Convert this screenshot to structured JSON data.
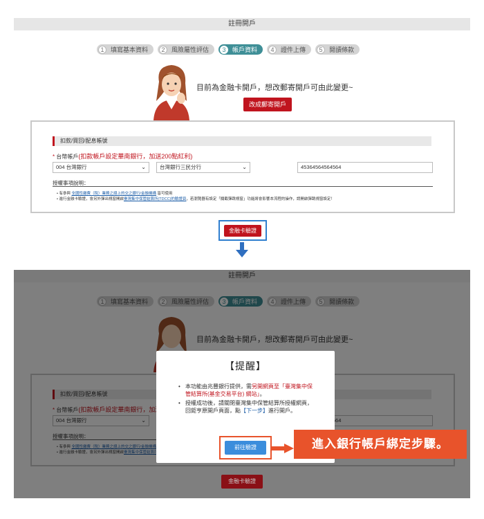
{
  "page_title": "註冊開戶",
  "steps": [
    {
      "num": "1",
      "label": "填寫基本資料",
      "active": false
    },
    {
      "num": "2",
      "label": "風險屬性評估",
      "active": false
    },
    {
      "num": "3",
      "label": "帳戶資料",
      "active": true
    },
    {
      "num": "4",
      "label": "證件上傳",
      "active": false
    },
    {
      "num": "5",
      "label": "閱讀條款",
      "active": false
    }
  ],
  "notice": "目前為金融卡開戶，想改郵寄開戶可由此變更~",
  "switch_button": "改成郵寄開戶",
  "form": {
    "section_title": "扣款/買回/配息帳號",
    "account_label_star": "*",
    "account_label": "台幣帳戶",
    "account_highlight": "(扣款帳戶設定華南銀行，加送200點紅利)",
    "bank_select": "004 台灣銀行",
    "branch_select": "台灣銀行三民分行",
    "account_number": "45364564564564",
    "explain_title": "授權事項說明：",
    "bullet1_pre": "• 有參與 ",
    "bullet1_link": "全國性繳費（稅）業務之總上的交之銀行/金融機構",
    "bullet1_post": " 皆可使用",
    "bullet2_pre": "• 進行金融卡驗證，會另外彈出視窗開啟",
    "bullet2_link": "臺灣集中保管結算所(TDCC)的驗證頁",
    "bullet2_post": "，若瀏覽器有設定「攔截彈跳視窗」功能將會影響本流程的操作，請開啟彈跳視窗設定！"
  },
  "verify_button": "金融卡驗證",
  "modal": {
    "title": "【提醒】",
    "item1_a": "本功能由兆豐銀行提供，需",
    "item1_red": "另開網頁至「臺灣集中保管結算所(基金交易平台) 網站」",
    "item1_b": "。",
    "item2_a": "授權成功後，請關閉臺灣集中保管結算所授權網頁，回鉅亨原開戶頁面，點",
    "item2_blue": "【下一步】",
    "item2_b": "進行開戶。",
    "go_button": "前往驗證"
  },
  "callout": "進入銀行帳戶綁定步驟。",
  "colors": {
    "accent_red": "#c0141e",
    "teal": "#3f8f97",
    "blue": "#3b8ddc",
    "orange": "#e8532b"
  }
}
